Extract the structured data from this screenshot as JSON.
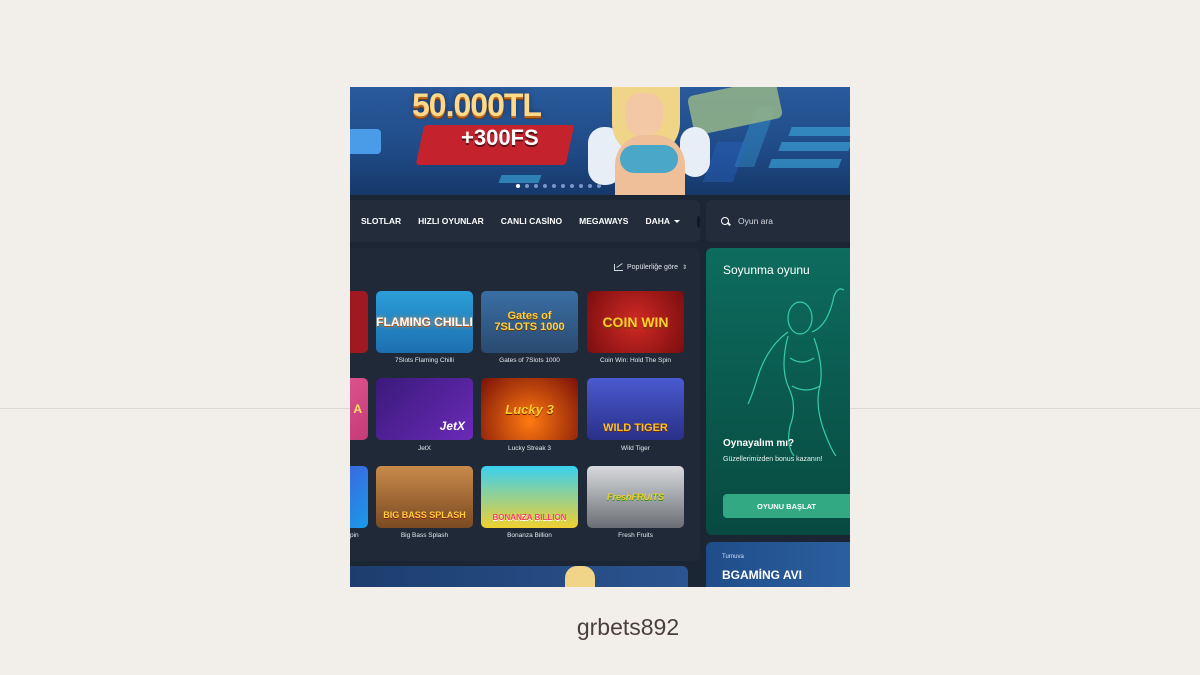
{
  "banner": {
    "amount": "50.000TL",
    "freespins": "+300FS",
    "carousel_dots": 10,
    "active_dot": 0
  },
  "nav": {
    "items": [
      "SLOTLAR",
      "HIZLI OYUNLAR",
      "CANLI CASİNO",
      "MEGAWAYS"
    ],
    "more_label": "DAHA"
  },
  "search": {
    "placeholder": "Oyun ara"
  },
  "games": {
    "sort_label": "Popülerliğe göre",
    "rows": [
      [
        {
          "name": "",
          "art_text": ""
        },
        {
          "name": "7Slots Flaming Chilli",
          "art_text": "FLAMING CHILLI"
        },
        {
          "name": "Gates of 7Slots 1000",
          "art_text": "Gates of 7SLOTS 1000"
        },
        {
          "name": "Coin Win: Hold The Spin",
          "art_text": "COIN WIN"
        }
      ],
      [
        {
          "name": "",
          "art_text": "A"
        },
        {
          "name": "JetX",
          "art_text": "JetX"
        },
        {
          "name": "Lucky Streak 3",
          "art_text": "Lucky 3"
        },
        {
          "name": "Wild Tiger",
          "art_text": "WILD TIGER"
        }
      ],
      [
        {
          "name": "pin",
          "art_text": ""
        },
        {
          "name": "Big Bass Splash",
          "art_text": "BIG BASS SPLASH"
        },
        {
          "name": "Bonanza Billion",
          "art_text": "BONANZA BILLION"
        },
        {
          "name": "Fresh Fruits",
          "art_text": "FreshFRUITS"
        }
      ]
    ]
  },
  "promo": {
    "title": "Soyunma oyunu",
    "question": "Oynayalım mı?",
    "subtitle": "Güzellerimizden bonus kazanın!",
    "button": "OYUNU BAŞLAT"
  },
  "tournament": {
    "kicker": "Turnuva",
    "title": "BGAMİNG AVI"
  },
  "caption": "grbets892",
  "colors": {
    "page_bg": "#f2efeb",
    "app_bg": "#1c2533",
    "panel": "#222c3b",
    "promo_green": "#0d6c5e",
    "button_green": "#32a983"
  }
}
